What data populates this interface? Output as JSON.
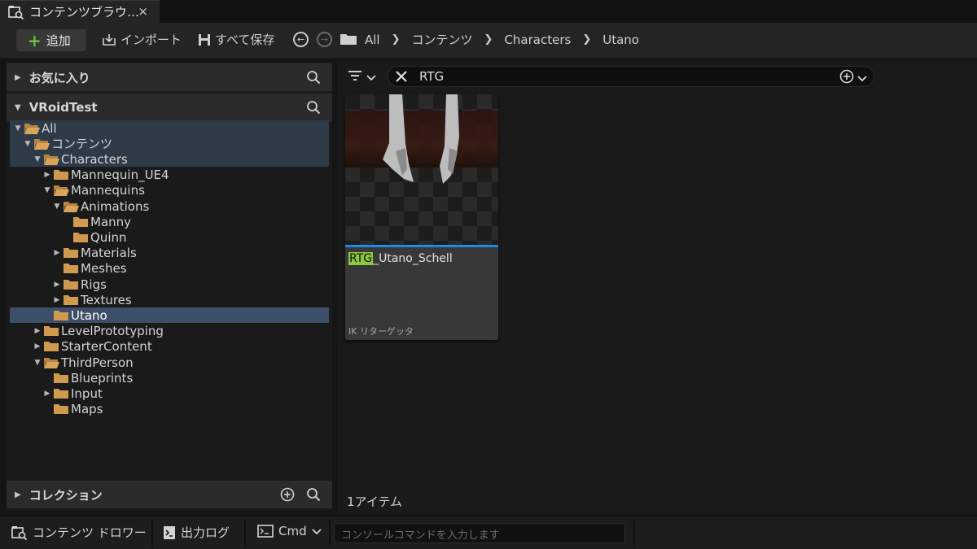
{
  "tab": {
    "title": "コンテンツブラウ…",
    "close": "×",
    "icon": "content-browser-icon"
  },
  "toolbar": {
    "add_label": "追加",
    "import_label": "インポート",
    "save_all_label": "すべて保存",
    "breadcrumbs": [
      "All",
      "コンテンツ",
      "Characters",
      "Utano"
    ]
  },
  "sources": {
    "favorites_label": "お気に入り",
    "project_label": "VRoidTest",
    "collections_label": "コレクション"
  },
  "tree": [
    {
      "label": "All",
      "level": 0,
      "expanded": true,
      "arrow": "down",
      "state": "hl"
    },
    {
      "label": "コンテンツ",
      "level": 1,
      "expanded": true,
      "arrow": "down",
      "state": "hl"
    },
    {
      "label": "Characters",
      "level": 2,
      "expanded": true,
      "arrow": "down",
      "state": "hl"
    },
    {
      "label": "Mannequin_UE4",
      "level": 3,
      "arrow": "right"
    },
    {
      "label": "Mannequins",
      "level": 3,
      "expanded": true,
      "arrow": "down"
    },
    {
      "label": "Animations",
      "level": 4,
      "expanded": true,
      "arrow": "down"
    },
    {
      "label": "Manny",
      "level": 5,
      "arrow": "none"
    },
    {
      "label": "Quinn",
      "level": 5,
      "arrow": "none"
    },
    {
      "label": "Materials",
      "level": 4,
      "arrow": "right"
    },
    {
      "label": "Meshes",
      "level": 4,
      "arrow": "none"
    },
    {
      "label": "Rigs",
      "level": 4,
      "arrow": "right"
    },
    {
      "label": "Textures",
      "level": 4,
      "arrow": "right"
    },
    {
      "label": "Utano",
      "level": 3,
      "arrow": "none",
      "state": "sel"
    },
    {
      "label": "LevelPrototyping",
      "level": 2,
      "arrow": "right"
    },
    {
      "label": "StarterContent",
      "level": 2,
      "arrow": "right"
    },
    {
      "label": "ThirdPerson",
      "level": 2,
      "expanded": true,
      "arrow": "down"
    },
    {
      "label": "Blueprints",
      "level": 3,
      "arrow": "none"
    },
    {
      "label": "Input",
      "level": 3,
      "arrow": "right"
    },
    {
      "label": "Maps",
      "level": 3,
      "arrow": "none"
    }
  ],
  "search": {
    "value": "RTG"
  },
  "asset": {
    "name_match": "RTG",
    "name_rest": "_Utano_Schell",
    "type": "IK リターゲッタ",
    "accent": "#1e88e5"
  },
  "item_count": "1アイテム",
  "bottom": {
    "content_drawer": "コンテンツ ドロワー",
    "output_log": "出力ログ",
    "cmd": "Cmd",
    "console_placeholder": "コンソールコマンドを入力します"
  },
  "colors": {
    "selection": "#3d4f68",
    "highlight": "#2f3a48",
    "add_plus": "#6fc34a",
    "search_match": "#8dc63f"
  }
}
